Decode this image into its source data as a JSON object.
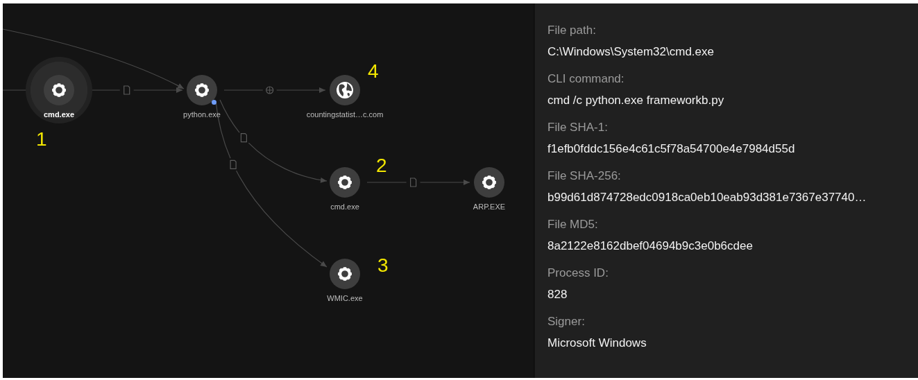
{
  "graph": {
    "nodes": [
      {
        "label": "cmd.exe",
        "kind": "process",
        "selected": true,
        "flagged": false,
        "callout": "1"
      },
      {
        "label": "python.exe",
        "kind": "process",
        "selected": false,
        "flagged": true
      },
      {
        "label": "countingstatist…c.com",
        "kind": "domain",
        "selected": false,
        "flagged": false,
        "callout": "4"
      },
      {
        "label": "cmd.exe",
        "kind": "process",
        "selected": false,
        "flagged": false,
        "callout": "2"
      },
      {
        "label": "ARP.EXE",
        "kind": "process",
        "selected": false,
        "flagged": false
      },
      {
        "label": "WMIC.exe",
        "kind": "process",
        "selected": false,
        "flagged": false,
        "callout": "3"
      }
    ],
    "edges": [
      {
        "kind": "plain"
      },
      {
        "kind": "plain"
      },
      {
        "kind": "file"
      },
      {
        "kind": "network"
      },
      {
        "kind": "file"
      },
      {
        "kind": "file"
      },
      {
        "kind": "file"
      }
    ]
  },
  "details": [
    {
      "label": "File path:",
      "value": "C:\\Windows\\System32\\cmd.exe"
    },
    {
      "label": "CLI command:",
      "value": "cmd /c python.exe frameworkb.py"
    },
    {
      "label": "File SHA-1:",
      "value": "f1efb0fddc156e4c61c5f78a54700e4e7984d55d"
    },
    {
      "label": "File SHA-256:",
      "value": "b99d61d874728edc0918ca0eb10eab93d381e7367e37740…"
    },
    {
      "label": "File MD5:",
      "value": "8a2122e8162dbef04694b9c3e0b6cdee"
    },
    {
      "label": "Process ID:",
      "value": "828"
    },
    {
      "label": "Signer:",
      "value": "Microsoft Windows"
    }
  ]
}
